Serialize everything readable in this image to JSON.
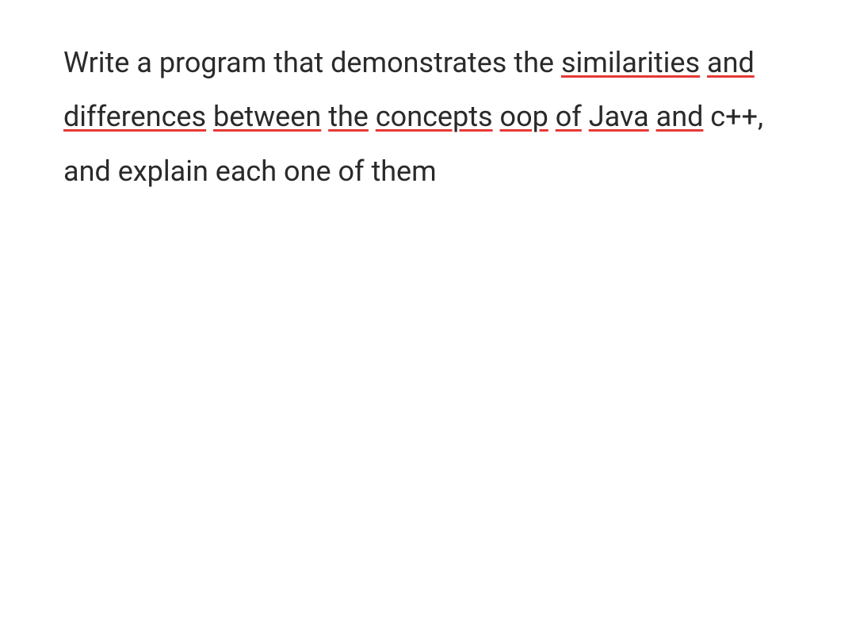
{
  "paragraph": {
    "segments": [
      {
        "text": "Write a program that demonstrates the ",
        "underlined": false
      },
      {
        "text": "similarities",
        "underlined": true
      },
      {
        "text": " ",
        "underlined": false
      },
      {
        "text": "and",
        "underlined": true
      },
      {
        "text": " ",
        "underlined": false
      },
      {
        "text": "differences",
        "underlined": true
      },
      {
        "text": " ",
        "underlined": false
      },
      {
        "text": "between",
        "underlined": true
      },
      {
        "text": " ",
        "underlined": false
      },
      {
        "text": "the",
        "underlined": true
      },
      {
        "text": " ",
        "underlined": false
      },
      {
        "text": "concepts",
        "underlined": true
      },
      {
        "text": " ",
        "underlined": false
      },
      {
        "text": "oop",
        "underlined": true
      },
      {
        "text": " ",
        "underlined": false
      },
      {
        "text": "of",
        "underlined": true
      },
      {
        "text": " ",
        "underlined": false
      },
      {
        "text": "Java",
        "underlined": true
      },
      {
        "text": " ",
        "underlined": false
      },
      {
        "text": "and",
        "underlined": true
      },
      {
        "text": " c++, and explain each one of them",
        "underlined": false
      }
    ]
  }
}
